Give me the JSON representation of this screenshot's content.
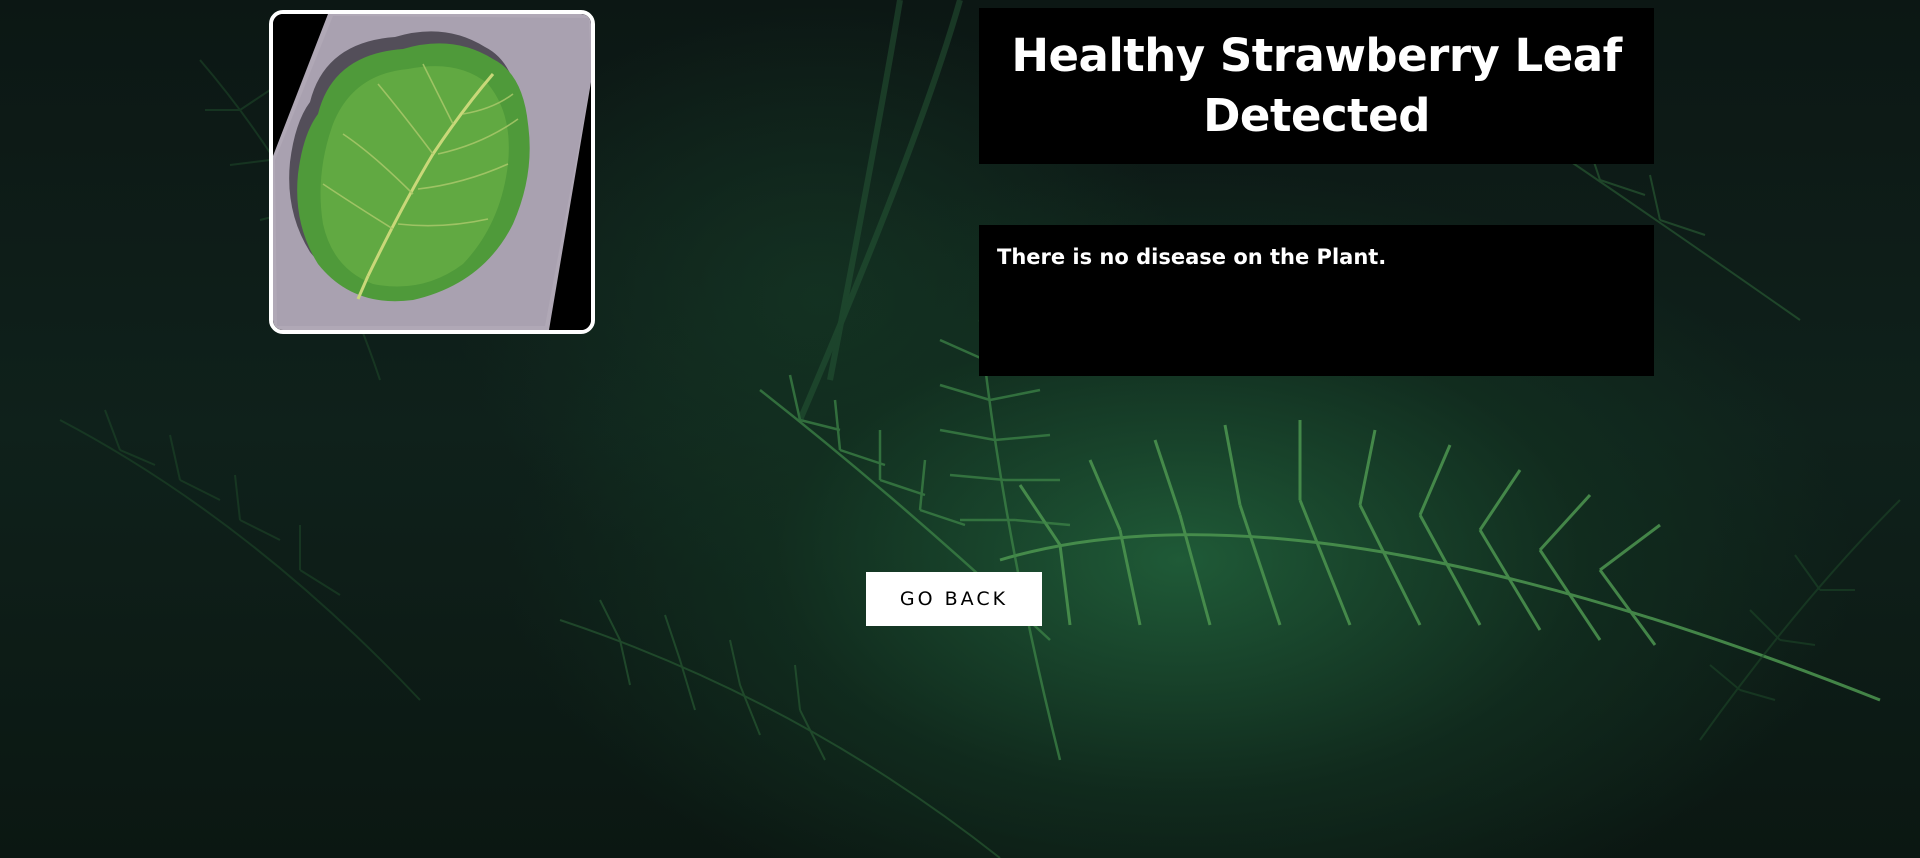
{
  "result": {
    "title": "Healthy Strawberry Leaf Detected",
    "description": "There is no disease on the Plant."
  },
  "actions": {
    "go_back_label": "GO BACK"
  },
  "colors": {
    "panel_background": "#000000",
    "panel_text": "#ffffff",
    "button_background": "#ffffff",
    "button_text": "#000000",
    "background_tone": "#1f5a37"
  },
  "images": {
    "uploaded_leaf": "strawberry-leaf-photo",
    "background": "fern-foliage-photo"
  }
}
